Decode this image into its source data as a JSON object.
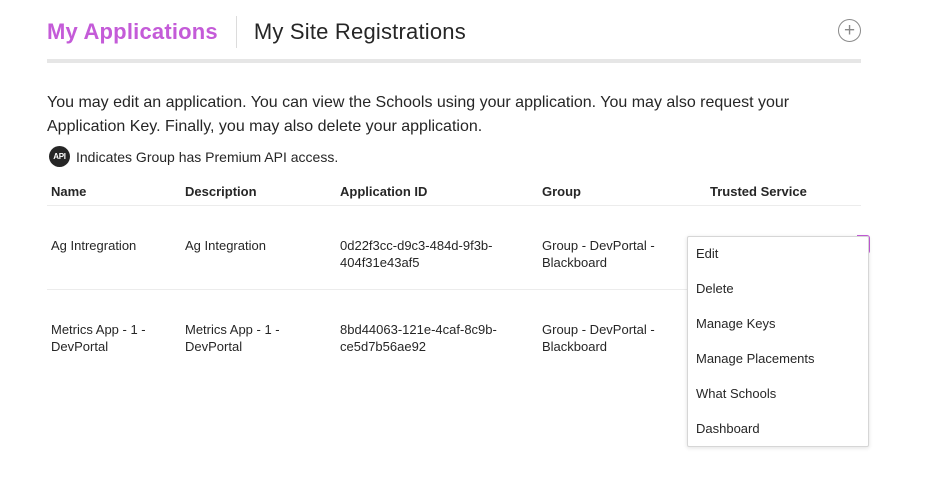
{
  "tabs": {
    "active": "My Applications",
    "other": "My Site Registrations"
  },
  "intro": {
    "line1": "You may edit an application. You can view the Schools using your application. You may also request your",
    "line2": "Application Key. Finally, you may also delete your application."
  },
  "legend": {
    "badge": "API",
    "text": "Indicates Group has Premium API access."
  },
  "table": {
    "headers": [
      "Name",
      "Description",
      "Application ID",
      "Group",
      "Trusted Service"
    ],
    "rows": [
      {
        "name": [
          "Ag Intregration"
        ],
        "description": [
          "Ag Integration"
        ],
        "app_id": [
          "0d22f3cc-d9c3-484d-9f3b-",
          "404f31e43af5"
        ],
        "group": [
          "Group - DevPortal -",
          "Blackboard"
        ]
      },
      {
        "name": [
          "Metrics App - 1 -",
          "DevPortal"
        ],
        "description": [
          "Metrics App - 1 -",
          "DevPortal"
        ],
        "app_id": [
          "8bd44063-121e-4caf-8c9b-",
          "ce5d7b56ae92"
        ],
        "group": [
          "Group - DevPortal -",
          "Blackboard"
        ]
      }
    ]
  },
  "menu": {
    "items": [
      "Edit",
      "Delete",
      "Manage Keys",
      "Manage Placements",
      "What Schools",
      "Dashboard"
    ]
  },
  "colors": {
    "accent": "#c45bd8",
    "text": "#262626",
    "divider": "#e6e6e6"
  },
  "icons": {
    "add": "plus-circle-icon",
    "premium": "api-badge-icon"
  }
}
